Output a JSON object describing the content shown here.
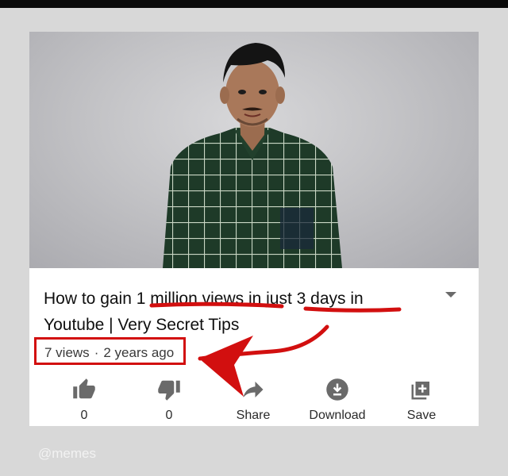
{
  "video": {
    "title_segments": [
      {
        "text": "How to gain ",
        "underlined": false
      },
      {
        "text": "1 million views",
        "underlined": true
      },
      {
        "text": " in ",
        "underlined": false
      },
      {
        "text": "just 3 days",
        "underlined": true
      },
      {
        "text": " in Youtube | Very Secret Tips",
        "underlined": false
      }
    ],
    "views": "7 views",
    "separator": "·",
    "age": "2 years ago"
  },
  "actions": {
    "like": {
      "label": "0",
      "icon": "thumbs-up-icon"
    },
    "dislike": {
      "label": "0",
      "icon": "thumbs-down-icon"
    },
    "share": {
      "label": "Share",
      "icon": "share-icon"
    },
    "download": {
      "label": "Download",
      "icon": "download-icon"
    },
    "save": {
      "label": "Save",
      "icon": "add-to-playlist-icon"
    }
  },
  "watermark": "@memes",
  "colors": {
    "annotation_red": "#d20f0f",
    "icon_gray": "#6a6a6a"
  }
}
